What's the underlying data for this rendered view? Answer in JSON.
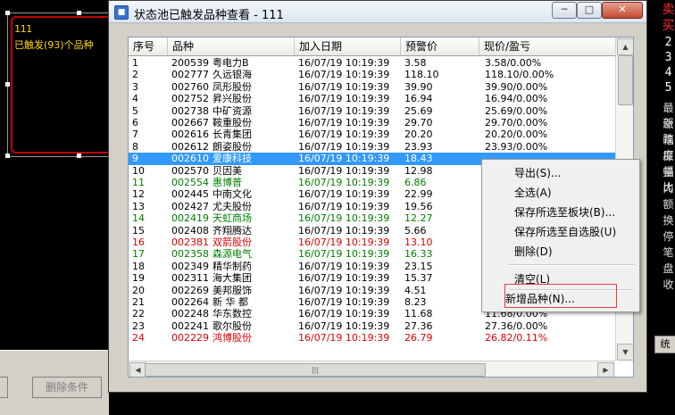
{
  "background_left": {
    "line1": "111",
    "line2": "已触发(93)个品种",
    "delete_button": "删除条件"
  },
  "background_right": {
    "red_chars": [
      "卖",
      "买"
    ],
    "numbers": [
      "2",
      "3",
      "4",
      "5"
    ],
    "labels": [
      "最新",
      "涨跌",
      "幅度",
      "振幅",
      "量比",
      "内",
      "额",
      "换",
      "停",
      "笔",
      "盘",
      "收"
    ],
    "button": "统"
  },
  "window": {
    "title": "状态池已触发品种查看 - 111",
    "min_symbol": "─",
    "max_symbol": "□",
    "close_symbol": "✕"
  },
  "table": {
    "headers": [
      "序号",
      "品种",
      "加入日期",
      "预警价",
      "现价/盈亏"
    ],
    "rows": [
      {
        "idx": "1",
        "code": "200539",
        "name": "粤电力B",
        "date": "16/07/19 10:19:39",
        "warn": "3.58",
        "now": "3.58/0.00%",
        "color": "#000000"
      },
      {
        "idx": "2",
        "code": "002777",
        "name": "久远银海",
        "date": "16/07/19 10:19:39",
        "warn": "118.10",
        "now": "118.10/0.00%",
        "color": "#000000"
      },
      {
        "idx": "3",
        "code": "002760",
        "name": "凤形股份",
        "date": "16/07/19 10:19:39",
        "warn": "39.90",
        "now": "39.90/0.00%",
        "color": "#000000"
      },
      {
        "idx": "4",
        "code": "002752",
        "name": "昇兴股份",
        "date": "16/07/19 10:19:39",
        "warn": "16.94",
        "now": "16.94/0.00%",
        "color": "#000000"
      },
      {
        "idx": "5",
        "code": "002738",
        "name": "中矿资源",
        "date": "16/07/19 10:19:39",
        "warn": "25.69",
        "now": "25.69/0.00%",
        "color": "#000000"
      },
      {
        "idx": "6",
        "code": "002667",
        "name": "鞍重股份",
        "date": "16/07/19 10:19:39",
        "warn": "29.70",
        "now": "29.70/0.00%",
        "color": "#000000"
      },
      {
        "idx": "7",
        "code": "002616",
        "name": "长青集团",
        "date": "16/07/19 10:19:39",
        "warn": "20.20",
        "now": "20.20/0.00%",
        "color": "#000000"
      },
      {
        "idx": "8",
        "code": "002612",
        "name": "朗姿股份",
        "date": "16/07/19 10:19:39",
        "warn": "23.93",
        "now": "23.93/0.00%",
        "color": "#000000"
      },
      {
        "idx": "9",
        "code": "002610",
        "name": "爱康科技",
        "date": "16/07/19 10:19:39",
        "warn": "18.43",
        "now": "",
        "color": "#ffffff",
        "selected": true
      },
      {
        "idx": "10",
        "code": "002570",
        "name": "贝因美",
        "date": "16/07/19 10:19:39",
        "warn": "12.98",
        "now": "",
        "color": "#000000"
      },
      {
        "idx": "11",
        "code": "002554",
        "name": "惠博普",
        "date": "16/07/19 10:19:39",
        "warn": "6.86",
        "now": "",
        "color": "#008000"
      },
      {
        "idx": "12",
        "code": "002445",
        "name": "中南文化",
        "date": "16/07/19 10:19:39",
        "warn": "22.99",
        "now": "",
        "color": "#000000"
      },
      {
        "idx": "13",
        "code": "002427",
        "name": "尤夫股份",
        "date": "16/07/19 10:19:39",
        "warn": "19.56",
        "now": "",
        "color": "#000000"
      },
      {
        "idx": "14",
        "code": "002419",
        "name": "天虹商场",
        "date": "16/07/19 10:19:39",
        "warn": "12.27",
        "now": "",
        "color": "#008000"
      },
      {
        "idx": "15",
        "code": "002408",
        "name": "齐翔腾达",
        "date": "16/07/19 10:19:39",
        "warn": "5.66",
        "now": "",
        "color": "#000000"
      },
      {
        "idx": "16",
        "code": "002381",
        "name": "双箭股份",
        "date": "16/07/19 10:19:39",
        "warn": "13.10",
        "now": "",
        "color": "#e00000"
      },
      {
        "idx": "17",
        "code": "002358",
        "name": "森源电气",
        "date": "16/07/19 10:19:39",
        "warn": "16.33",
        "now": "",
        "color": "#008000"
      },
      {
        "idx": "18",
        "code": "002349",
        "name": "精华制药",
        "date": "16/07/19 10:19:39",
        "warn": "23.15",
        "now": "",
        "color": "#000000"
      },
      {
        "idx": "19",
        "code": "002311",
        "name": "海大集团",
        "date": "16/07/19 10:19:39",
        "warn": "15.37",
        "now": "",
        "color": "#000000"
      },
      {
        "idx": "20",
        "code": "002269",
        "name": "美邦服饰",
        "date": "16/07/19 10:19:39",
        "warn": "4.51",
        "now": "",
        "color": "#000000"
      },
      {
        "idx": "21",
        "code": "002264",
        "name": "新 华 都",
        "date": "16/07/19 10:19:39",
        "warn": "8.23",
        "now": "8.23/0.00%",
        "color": "#000000"
      },
      {
        "idx": "22",
        "code": "002248",
        "name": "华东数控",
        "date": "16/07/19 10:19:39",
        "warn": "11.68",
        "now": "11.68/0.00%",
        "color": "#000000"
      },
      {
        "idx": "23",
        "code": "002241",
        "name": "歌尔股份",
        "date": "16/07/19 10:19:39",
        "warn": "27.36",
        "now": "27.36/0.00%",
        "color": "#000000"
      },
      {
        "idx": "24",
        "code": "002229",
        "name": "鸿博股份",
        "date": "16/07/19 10:19:39",
        "warn": "26.79",
        "now": "26.82/0.11%",
        "color": "#e00000"
      }
    ]
  },
  "context_menu": {
    "items": [
      "导出(S)...",
      "全选(A)",
      "保存所选至板块(B)...",
      "保存所选至自选股(U)",
      "删除(D)",
      "清空(L)",
      "新增品种(N)..."
    ]
  }
}
